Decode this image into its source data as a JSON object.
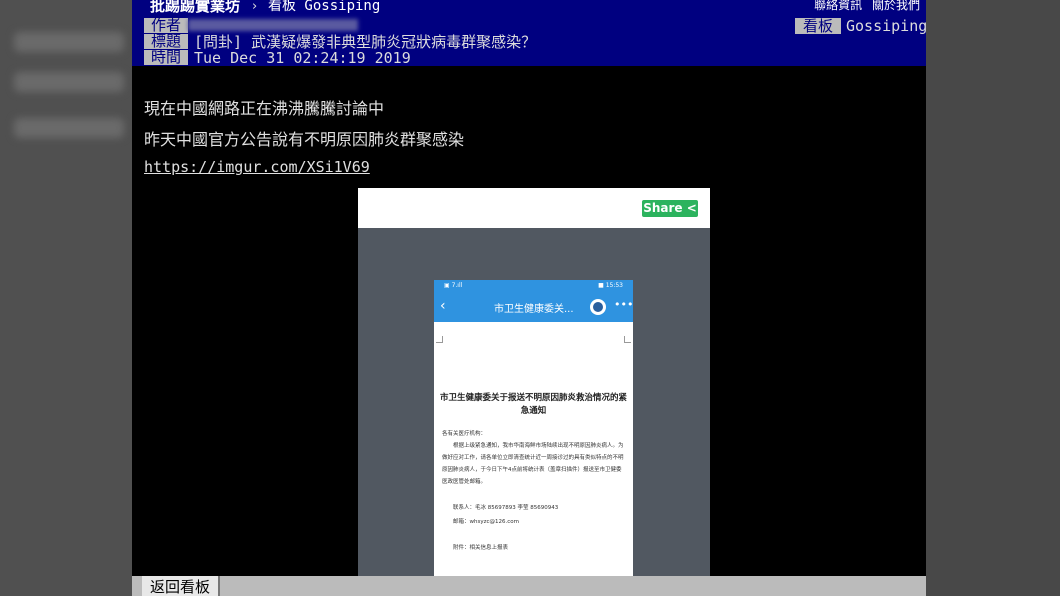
{
  "topbar": {
    "brand": "批踢踢實業坊",
    "separator": "›",
    "board_label": "看板 Gossiping",
    "links": [
      "聯絡資訊",
      "關於我們"
    ]
  },
  "header": {
    "author_label": "作者",
    "title_label": "標題",
    "time_label": "時間",
    "board_tag": "看板",
    "board_value": "Gossiping",
    "title_value": "[問卦] 武漢疑爆發非典型肺炎冠狀病毒群聚感染？",
    "time_value": "Tue Dec 31 02:24:19 2019"
  },
  "body": {
    "line1": "現在中國網路正在沸沸騰騰討論中",
    "line2": "昨天中國官方公告說有不明原因肺炎群聚感染",
    "link": "https://imgur.com/XSi1V69"
  },
  "embed": {
    "share_label": "Share <",
    "phone": {
      "status_left": "▣ 7.ıll",
      "status_right": "■ 15:53",
      "back": "‹",
      "appbar_title": "市卫生健康委关...",
      "more": "•••",
      "doc_title": "市卫生健康委关于报送不明原因肺炎救治情况的紧急通知",
      "salutation": "各有关医疗机构：",
      "notice": "根据上级紧急通知，我市华南海鲜市场陆续出现不明原因肺炎病人。为做好应对工作，请各单位立即清查统计近一周接诊过的具有类似特点的不明原因肺炎病人，于今日下午4点前将统计表（盖章扫描件）报送至市卫健委医政医管处邮箱。",
      "contacts": "联系人：毛冰  85697893    李莹  85690943",
      "email": "邮箱：whsyzc@126.com",
      "attachment": "附件：相关信息上报表"
    }
  },
  "footer": {
    "back_label": "返回看板"
  }
}
